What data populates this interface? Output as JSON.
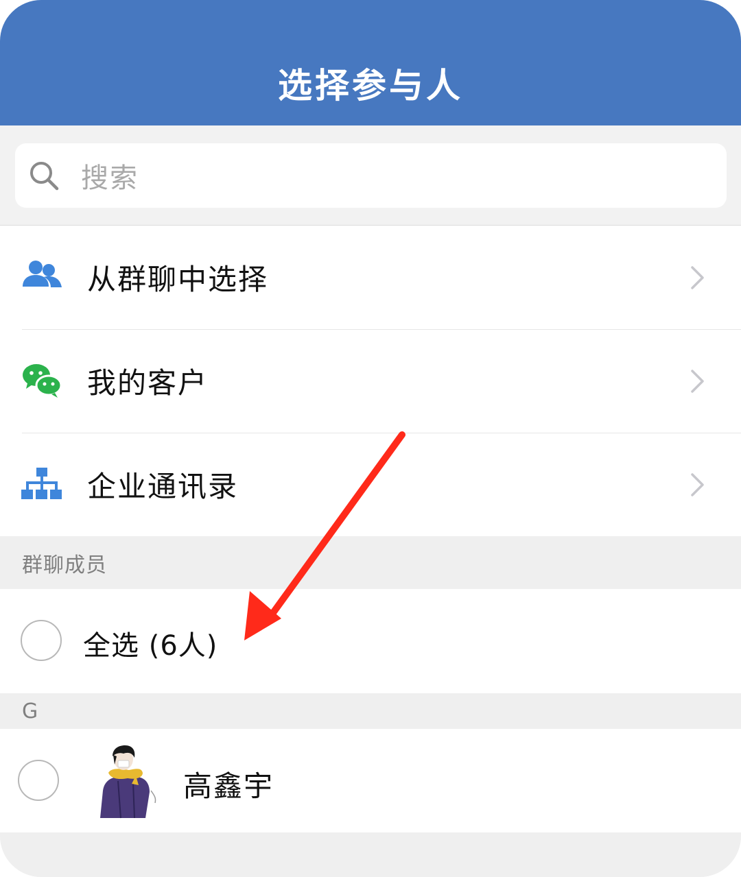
{
  "header": {
    "title": "选择参与人"
  },
  "search": {
    "placeholder": "搜索"
  },
  "menu": {
    "items": [
      {
        "label": "从群聊中选择",
        "icon": "group-chat-icon"
      },
      {
        "label": "我的客户",
        "icon": "wechat-icon"
      },
      {
        "label": "企业通讯录",
        "icon": "org-chart-icon"
      }
    ]
  },
  "sections": {
    "group_members": "群聊成员",
    "letter_g": "G"
  },
  "select_all": {
    "label": "全选 (6人)"
  },
  "members": [
    {
      "name": "高鑫宇",
      "avatar": "avatar-image"
    }
  ],
  "colors": {
    "header_bg": "#4778c0",
    "icon_blue": "#3f86db",
    "icon_green": "#2bb24c",
    "annotation_red": "#ff2a1a"
  }
}
